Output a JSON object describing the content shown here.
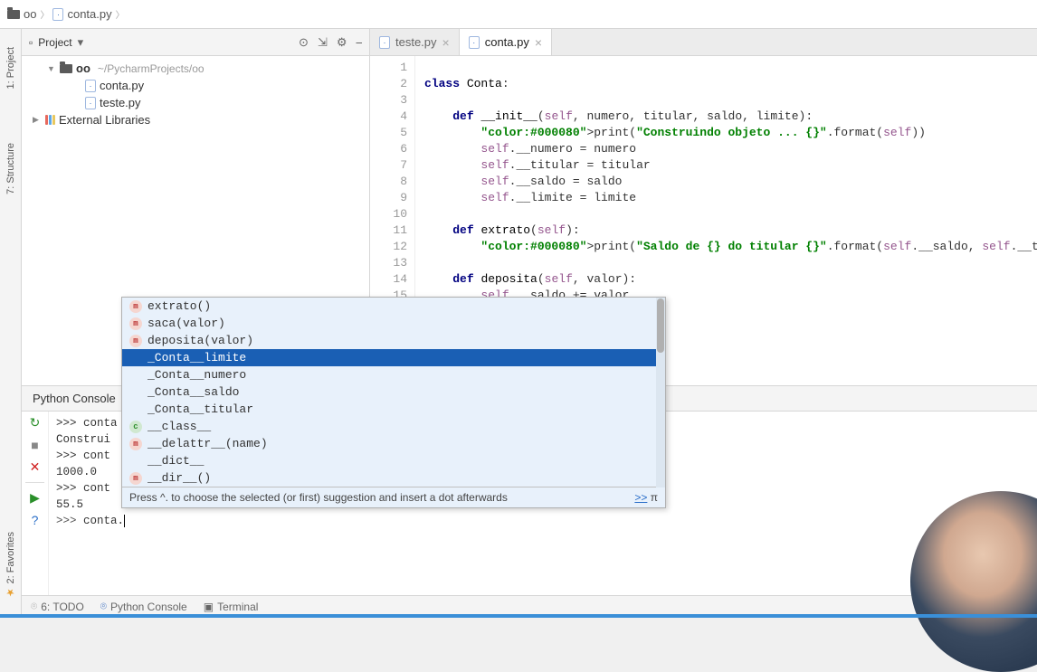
{
  "breadcrumb": {
    "root": "oo",
    "file": "conta.py"
  },
  "left_tools": {
    "project": "1: Project",
    "structure": "7: Structure",
    "favorites": "2: Favorites"
  },
  "project_panel": {
    "title": "Project",
    "root": "oo",
    "root_path": "~/PycharmProjects/oo",
    "files": [
      "conta.py",
      "teste.py"
    ],
    "external": "External Libraries"
  },
  "editor": {
    "tabs": [
      {
        "label": "teste.py",
        "active": false
      },
      {
        "label": "conta.py",
        "active": true
      }
    ],
    "code_lines": [
      {
        "n": 1,
        "text": ""
      },
      {
        "n": 2,
        "text": "class Conta:",
        "kind": "class"
      },
      {
        "n": 3,
        "text": ""
      },
      {
        "n": 4,
        "text": "    def __init__(self, numero, titular, saldo, limite):",
        "kind": "def"
      },
      {
        "n": 5,
        "text": "        print(\"Construindo objeto ... {}\".format(self))",
        "kind": "print"
      },
      {
        "n": 6,
        "text": "        self.__numero = numero",
        "kind": "assign"
      },
      {
        "n": 7,
        "text": "        self.__titular = titular",
        "kind": "assign"
      },
      {
        "n": 8,
        "text": "        self.__saldo = saldo",
        "kind": "assign"
      },
      {
        "n": 9,
        "text": "        self.__limite = limite",
        "kind": "assign"
      },
      {
        "n": 10,
        "text": ""
      },
      {
        "n": 11,
        "text": "    def extrato(self):",
        "kind": "def"
      },
      {
        "n": 12,
        "text": "        print(\"Saldo de {} do titular {}\".format(self.__saldo, self.__titular))",
        "kind": "print"
      },
      {
        "n": 13,
        "text": ""
      },
      {
        "n": 14,
        "text": "    def deposita(self, valor):",
        "kind": "def"
      },
      {
        "n": 15,
        "text": "        self.__saldo += valor",
        "kind": "assign"
      }
    ]
  },
  "console": {
    "tab": "Python Console",
    "lines": [
      ">>> conta",
      "Construi",
      ">>> cont",
      "1000.0",
      ">>> cont",
      "55.5",
      "",
      ">>> conta."
    ]
  },
  "autocomplete": {
    "items": [
      {
        "icon": "m",
        "label": "extrato()"
      },
      {
        "icon": "m",
        "label": "saca(valor)"
      },
      {
        "icon": "m",
        "label": "deposita(valor)"
      },
      {
        "icon": "",
        "label": "_Conta__limite",
        "selected": true
      },
      {
        "icon": "",
        "label": "_Conta__numero"
      },
      {
        "icon": "",
        "label": "_Conta__saldo"
      },
      {
        "icon": "",
        "label": "_Conta__titular"
      },
      {
        "icon": "c",
        "label": "__class__"
      },
      {
        "icon": "m",
        "label": "__delattr__(name)"
      },
      {
        "icon": "",
        "label": "__dict__"
      },
      {
        "icon": "m",
        "label": "__dir__()"
      }
    ],
    "hint": "Press ^. to choose the selected (or first) suggestion and insert a dot afterwards",
    "hint_link": ">>",
    "hint_pi": "π"
  },
  "bottom": {
    "todo": "6: TODO",
    "console": "Python Console",
    "terminal": "Terminal"
  }
}
